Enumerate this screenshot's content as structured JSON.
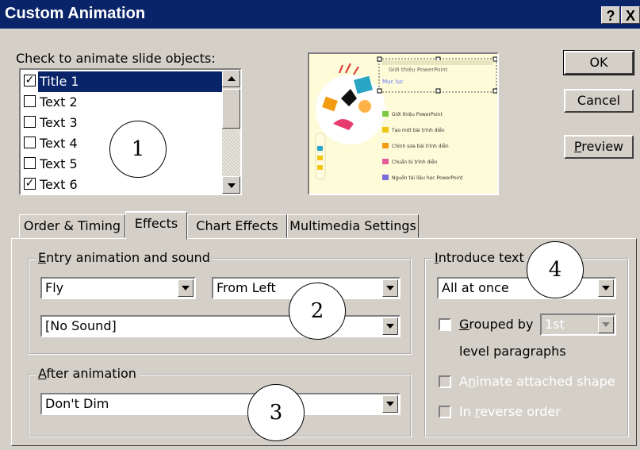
{
  "window": {
    "title": "Custom Animation",
    "help_label": "?",
    "close_label": "X"
  },
  "objects": {
    "label": "Check to animate slide objects:",
    "items": [
      {
        "label": "Title 1",
        "checked": true,
        "selected": true
      },
      {
        "label": "Text 2",
        "checked": false,
        "selected": false
      },
      {
        "label": "Text 3",
        "checked": false,
        "selected": false
      },
      {
        "label": "Text 4",
        "checked": false,
        "selected": false
      },
      {
        "label": "Text 5",
        "checked": false,
        "selected": false
      },
      {
        "label": "Text 6",
        "checked": true,
        "selected": false
      }
    ]
  },
  "preview": {
    "title_line": "Giới thiệu PowerPoint",
    "subtitle": "Mục lục",
    "bullets": [
      "Giới thiệu PowerPoint",
      "Tạo một bài trình diễn",
      "Chỉnh sửa bài trình diễn",
      "Chuẩn bị trình diễn",
      "Nguồn tài liệu học PowerPoint"
    ]
  },
  "buttons": {
    "ok": "OK",
    "cancel": "Cancel",
    "preview": "Preview"
  },
  "callouts": [
    "1",
    "2",
    "3",
    "4"
  ],
  "tabs": [
    {
      "label": "Order & Timing",
      "active": false
    },
    {
      "label": "Effects",
      "active": true
    },
    {
      "label": "Chart Effects",
      "active": false
    },
    {
      "label": "Multimedia Settings",
      "active": false
    }
  ],
  "entry": {
    "group_label": "Entry animation and sound",
    "effect": "Fly",
    "direction": "From Left",
    "sound": "[No Sound]"
  },
  "after": {
    "group_label": "After animation",
    "value": "Don't Dim"
  },
  "introduce": {
    "group_label": "Introduce text",
    "value": "All at once",
    "grouped_label": "Grouped by",
    "grouped_value": "1st",
    "level_label": "level paragraphs",
    "attached_label": "Animate attached shape",
    "reverse_label": "In reverse order"
  },
  "colors": {
    "title_bar": "#0a246a",
    "face": "#d4d0c8",
    "selection": "#0a246a"
  }
}
